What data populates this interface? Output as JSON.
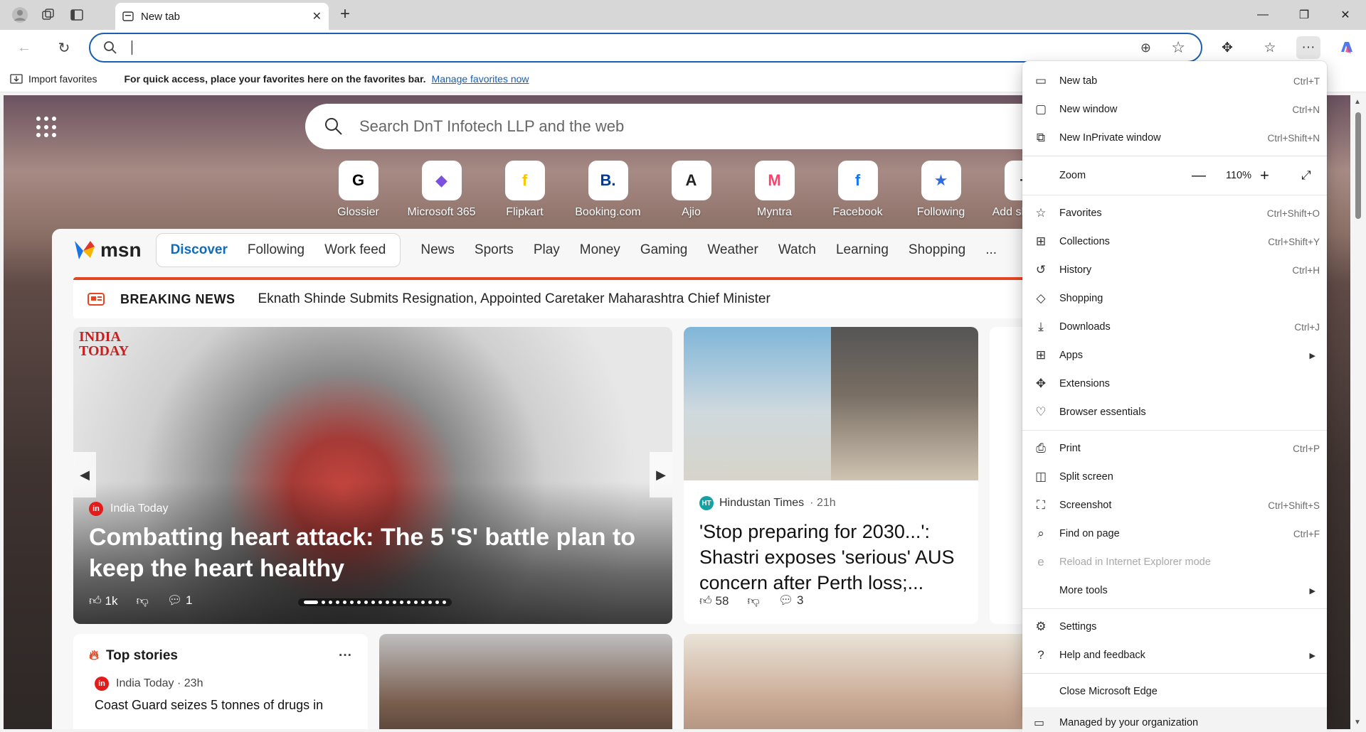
{
  "tab": {
    "title": "New tab"
  },
  "address_bar": {
    "value": ""
  },
  "favorites_bar": {
    "import_label": "Import favorites",
    "hint": "For quick access, place your favorites here on the favorites bar.",
    "manage_link": "Manage favorites now"
  },
  "newtab": {
    "search_placeholder": "Search DnT Infotech LLP and the web",
    "quick_links": [
      {
        "label": "Glossier",
        "glyph": "G",
        "color": "#000000"
      },
      {
        "label": "Microsoft 365",
        "glyph": "◆",
        "color": "#7b4fe0"
      },
      {
        "label": "Flipkart",
        "glyph": "f",
        "color": "#f7c800"
      },
      {
        "label": "Booking.com",
        "glyph": "B.",
        "color": "#003b95"
      },
      {
        "label": "Ajio",
        "glyph": "A",
        "color": "#222222"
      },
      {
        "label": "Myntra",
        "glyph": "M",
        "color": "#ff3f6c"
      },
      {
        "label": "Facebook",
        "glyph": "f",
        "color": "#1877f2"
      },
      {
        "label": "Following",
        "glyph": "★",
        "color": "#2f6ae6"
      },
      {
        "label": "Add shortcut",
        "glyph": "+",
        "color": "#333333"
      }
    ]
  },
  "msn": {
    "brand": "msn",
    "segments": [
      "Discover",
      "Following",
      "Work feed"
    ],
    "categories": [
      "News",
      "Sports",
      "Play",
      "Money",
      "Gaming",
      "Weather",
      "Watch",
      "Learning",
      "Shopping",
      "..."
    ],
    "breaking_label": "BREAKING NEWS",
    "breaking_text": "Eknath Shinde Submits Resignation, Appointed Caretaker Maharashtra Chief Minister",
    "hero": {
      "brand_line1": "INDIA",
      "brand_line2": "TODAY",
      "source": "India Today",
      "headline": "Combatting heart attack: The 5 'S' battle plan to keep the heart healthy",
      "likes": "1k",
      "comments": "1"
    },
    "story2": {
      "source": "Hindustan Times",
      "time": "· 21h",
      "headline": "'Stop preparing for 2030...': Shastri exposes 'serious' AUS concern after Perth loss;...",
      "likes": "58",
      "comments": "3"
    },
    "top_stories": {
      "title": "Top stories",
      "more": "···",
      "source": "India Today · 23h",
      "headline": "Coast Guard seizes 5 tonnes of drugs in"
    }
  },
  "menu": {
    "items_group1": [
      {
        "label": "New tab",
        "shortcut": "Ctrl+T",
        "icon": "new-tab-icon",
        "glyph": "▭"
      },
      {
        "label": "New window",
        "shortcut": "Ctrl+N",
        "icon": "new-window-icon",
        "glyph": "▢"
      },
      {
        "label": "New InPrivate window",
        "shortcut": "Ctrl+Shift+N",
        "icon": "inprivate-icon",
        "glyph": "⧉"
      }
    ],
    "zoom": {
      "label": "Zoom",
      "value": "110%"
    },
    "items_group2": [
      {
        "label": "Favorites",
        "shortcut": "Ctrl+Shift+O",
        "icon": "favorites-icon",
        "glyph": "☆"
      },
      {
        "label": "Collections",
        "shortcut": "Ctrl+Shift+Y",
        "icon": "collections-icon",
        "glyph": "⊞"
      },
      {
        "label": "History",
        "shortcut": "Ctrl+H",
        "icon": "history-icon",
        "glyph": "↺"
      },
      {
        "label": "Shopping",
        "shortcut": "",
        "icon": "shopping-tag-icon",
        "glyph": "◇"
      },
      {
        "label": "Downloads",
        "shortcut": "Ctrl+J",
        "icon": "download-icon",
        "glyph": "⤓"
      },
      {
        "label": "Apps",
        "shortcut": "",
        "icon": "apps-icon",
        "glyph": "⊞",
        "submenu": true
      },
      {
        "label": "Extensions",
        "shortcut": "",
        "icon": "extensions-icon",
        "glyph": "✥"
      },
      {
        "label": "Browser essentials",
        "shortcut": "",
        "icon": "heart-pulse-icon",
        "glyph": "♡"
      }
    ],
    "items_group3": [
      {
        "label": "Print",
        "shortcut": "Ctrl+P",
        "icon": "print-icon",
        "glyph": "⎙"
      },
      {
        "label": "Split screen",
        "shortcut": "",
        "icon": "split-screen-icon",
        "glyph": "◫"
      },
      {
        "label": "Screenshot",
        "shortcut": "Ctrl+Shift+S",
        "icon": "screenshot-icon",
        "glyph": "⛶"
      },
      {
        "label": "Find on page",
        "shortcut": "Ctrl+F",
        "icon": "find-icon",
        "glyph": "⌕"
      },
      {
        "label": "Reload in Internet Explorer mode",
        "shortcut": "",
        "icon": "ie-mode-icon",
        "glyph": "e",
        "disabled": true
      },
      {
        "label": "More tools",
        "shortcut": "",
        "icon": "more-tools-icon",
        "glyph": "",
        "submenu": true
      }
    ],
    "items_group4": [
      {
        "label": "Settings",
        "shortcut": "",
        "icon": "settings-icon",
        "glyph": "⚙"
      },
      {
        "label": "Help and feedback",
        "shortcut": "",
        "icon": "help-icon",
        "glyph": "?",
        "submenu": true
      }
    ],
    "close_label": "Close Microsoft Edge",
    "managed_label": "Managed by your organization"
  }
}
